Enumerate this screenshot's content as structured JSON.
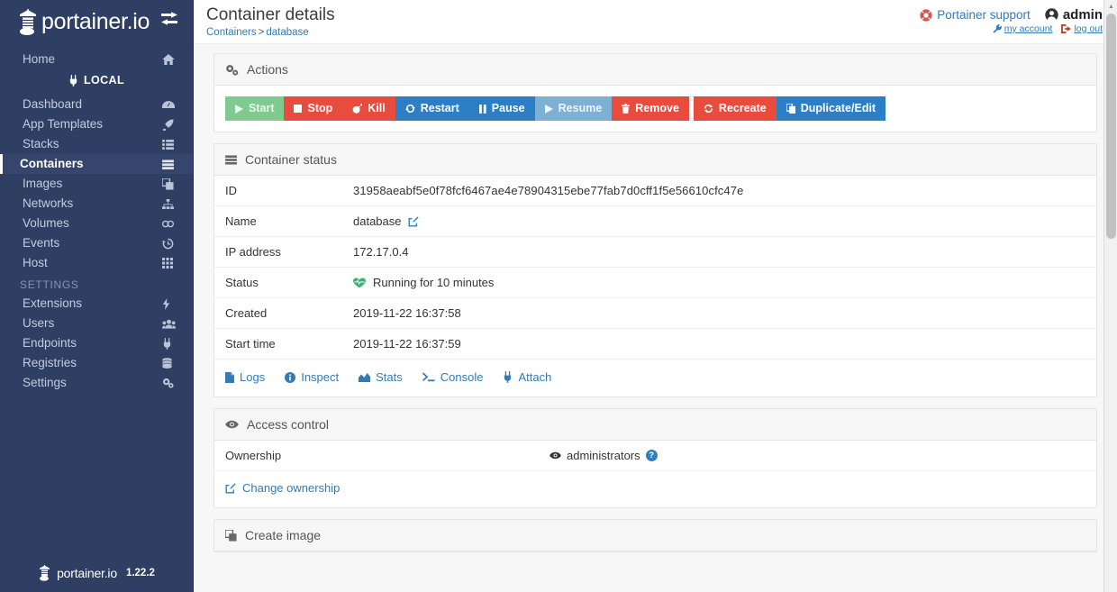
{
  "sidebar": {
    "brand": "portainer.io",
    "toggle_icon": "collapse-toggle-icon",
    "home_label": "Home",
    "endpoint_label": "LOCAL",
    "section_label": "SETTINGS",
    "items_main": [
      {
        "label": "Dashboard",
        "icon": "tachometer-icon",
        "active": false
      },
      {
        "label": "App Templates",
        "icon": "rocket-icon",
        "active": false
      },
      {
        "label": "Stacks",
        "icon": "list-icon",
        "active": false
      },
      {
        "label": "Containers",
        "icon": "server-icon",
        "active": true
      },
      {
        "label": "Images",
        "icon": "clone-icon",
        "active": false
      },
      {
        "label": "Networks",
        "icon": "sitemap-icon",
        "active": false
      },
      {
        "label": "Volumes",
        "icon": "hdd-icon",
        "active": false
      },
      {
        "label": "Events",
        "icon": "history-icon",
        "active": false
      },
      {
        "label": "Host",
        "icon": "th-icon",
        "active": false
      }
    ],
    "items_settings": [
      {
        "label": "Extensions",
        "icon": "bolt-icon"
      },
      {
        "label": "Users",
        "icon": "users-icon"
      },
      {
        "label": "Endpoints",
        "icon": "plug-icon"
      },
      {
        "label": "Registries",
        "icon": "database-icon"
      },
      {
        "label": "Settings",
        "icon": "cogs-icon"
      }
    ],
    "footer": {
      "brand": "portainer.io",
      "version": "1.22.2"
    }
  },
  "header": {
    "title": "Container details",
    "breadcrumb": {
      "parent": "Containers",
      "separator": ">",
      "current": "database"
    },
    "support_label": "Portainer support",
    "support_icon": "life-ring-icon",
    "user_label": "admin",
    "user_icon": "user-circle-icon",
    "my_account_label": "my account",
    "my_account_icon": "wrench-icon",
    "logout_label": "log out",
    "logout_icon": "sign-out-icon"
  },
  "actions_panel": {
    "title": "Actions",
    "icon": "cogs-icon",
    "buttons": [
      {
        "label": "Start",
        "icon": "play-icon",
        "style": "green"
      },
      {
        "label": "Stop",
        "icon": "stop-icon",
        "style": "red"
      },
      {
        "label": "Kill",
        "icon": "bomb-icon",
        "style": "red"
      },
      {
        "label": "Restart",
        "icon": "sync-icon",
        "style": "blue"
      },
      {
        "label": "Pause",
        "icon": "pause-icon",
        "style": "blue"
      },
      {
        "label": "Resume",
        "icon": "play-icon",
        "style": "blue-d"
      },
      {
        "label": "Remove",
        "icon": "trash-icon",
        "style": "red"
      },
      {
        "label": "Recreate",
        "icon": "sync-icon",
        "style": "red",
        "gap_before": true
      },
      {
        "label": "Duplicate/Edit",
        "icon": "copy-icon",
        "style": "blue"
      }
    ]
  },
  "status_panel": {
    "title": "Container status",
    "icon": "server-icon",
    "rows": [
      {
        "key": "ID",
        "value": "31958aeabf5e0f78fcf6467ae4e78904315ebe77fab7d0cff1f5e56610cfc47e",
        "type": "text"
      },
      {
        "key": "Name",
        "value": "database",
        "type": "editable",
        "edit_icon": "edit-icon"
      },
      {
        "key": "IP address",
        "value": "172.17.0.4",
        "type": "text"
      },
      {
        "key": "Status",
        "value": "Running for 10 minutes",
        "type": "status",
        "status_icon": "heartbeat-icon"
      },
      {
        "key": "Created",
        "value": "2019-11-22 16:37:58",
        "type": "text"
      },
      {
        "key": "Start time",
        "value": "2019-11-22 16:37:59",
        "type": "text"
      }
    ],
    "links": [
      {
        "label": "Logs",
        "icon": "file-icon"
      },
      {
        "label": "Inspect",
        "icon": "info-circle-icon"
      },
      {
        "label": "Stats",
        "icon": "chart-area-icon"
      },
      {
        "label": "Console",
        "icon": "terminal-icon"
      },
      {
        "label": "Attach",
        "icon": "plug-icon"
      }
    ]
  },
  "access_panel": {
    "title": "Access control",
    "icon": "eye-icon",
    "ownership_label": "Ownership",
    "ownership_value": "administrators",
    "ownership_icon": "eye-icon",
    "help_icon": "question-icon",
    "help_text": "?",
    "change_label": "Change ownership",
    "change_icon": "edit-icon"
  },
  "create_image_panel": {
    "title": "Create image",
    "icon": "clone-icon"
  },
  "colors": {
    "sidebar_bg": "#2f3e63",
    "link_blue": "#337ab7",
    "btn_red": "#e74c3c",
    "btn_blue": "#2c7fc4",
    "btn_green": "#7fca8f",
    "status_green": "#3bb273",
    "support_red": "#d9534f"
  },
  "scrollbar": {
    "up_arrow": "▲",
    "down_arrow": "▼"
  }
}
